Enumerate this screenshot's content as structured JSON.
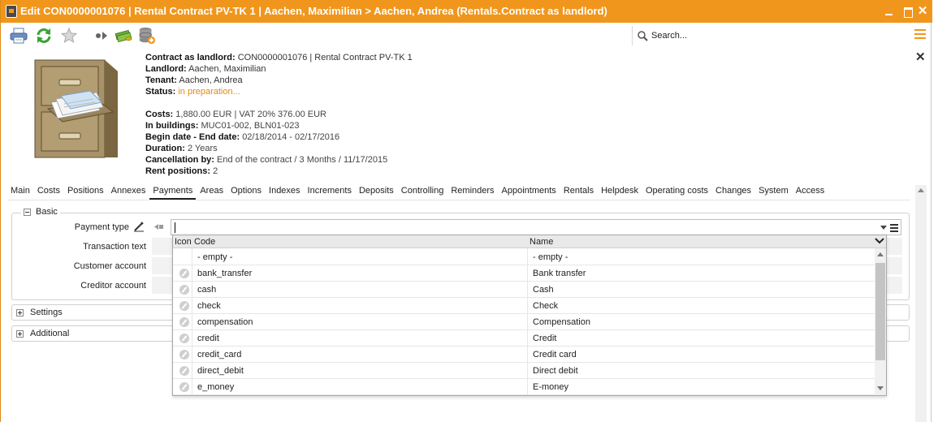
{
  "window": {
    "title": "Edit CON0000001076 | Rental Contract PV-TK 1 | Aachen, Maximilian > Aachen, Andrea (Rentals.Contract as landlord)",
    "close_glyph": "✕"
  },
  "toolbar": {
    "icons": [
      "printer-icon",
      "refresh-icon",
      "favorite-star-icon",
      "forward-icon",
      "money-icon",
      "database-add-icon"
    ],
    "search_label": "Search...",
    "close_glyph": "✕"
  },
  "header": {
    "contract_label": "Contract as landlord:",
    "contract_value": "CON0000001076 | Rental Contract PV-TK 1",
    "landlord_label": "Landlord:",
    "landlord_value": "Aachen, Maximilian",
    "tenant_label": "Tenant:",
    "tenant_value": "Aachen, Andrea",
    "status_label": "Status:",
    "status_value": "in preparation...",
    "costs_label": "Costs:",
    "costs_value": "1,880.00 EUR | VAT 20% 376.00 EUR",
    "buildings_label": "In buildings:",
    "buildings_value": "MUC01-002, BLN01-023",
    "dates_label": "Begin date - End date:",
    "dates_value": "02/18/2014 - 02/17/2016",
    "duration_label": "Duration:",
    "duration_value": "2 Years",
    "cancellation_label": "Cancellation by:",
    "cancellation_value": "End of the contract / 3 Months / 11/17/2015",
    "rent_positions_label": "Rent positions:",
    "rent_positions_value": "2"
  },
  "tabs": [
    "Main",
    "Costs",
    "Positions",
    "Annexes",
    "Payments",
    "Areas",
    "Options",
    "Indexes",
    "Increments",
    "Deposits",
    "Controlling",
    "Reminders",
    "Appointments",
    "Rentals",
    "Helpdesk",
    "Operating costs",
    "Changes",
    "System",
    "Access"
  ],
  "active_tab": "Payments",
  "form": {
    "basic_title": "Basic",
    "payment_type_label": "Payment type",
    "payment_type_value": "",
    "transaction_text_label": "Transaction text",
    "customer_account_label": "Customer account",
    "creditor_account_label": "Creditor account",
    "settings_title": "Settings",
    "additional_title": "Additional"
  },
  "dropdown": {
    "col_icon": "Icon",
    "col_code": "Code",
    "col_name": "Name",
    "rows": [
      {
        "code": "- empty -",
        "name": "- empty -",
        "icon": false
      },
      {
        "code": "bank_transfer",
        "name": "Bank transfer",
        "icon": true
      },
      {
        "code": "cash",
        "name": "Cash",
        "icon": true
      },
      {
        "code": "check",
        "name": "Check",
        "icon": true
      },
      {
        "code": "compensation",
        "name": "Compensation",
        "icon": true
      },
      {
        "code": "credit",
        "name": "Credit",
        "icon": true
      },
      {
        "code": "credit_card",
        "name": "Credit card",
        "icon": true
      },
      {
        "code": "direct_debit",
        "name": "Direct debit",
        "icon": true
      },
      {
        "code": "e_money",
        "name": "E-money",
        "icon": true
      }
    ]
  },
  "colors": {
    "accent": "#f0961c",
    "status": "#e08a14"
  }
}
